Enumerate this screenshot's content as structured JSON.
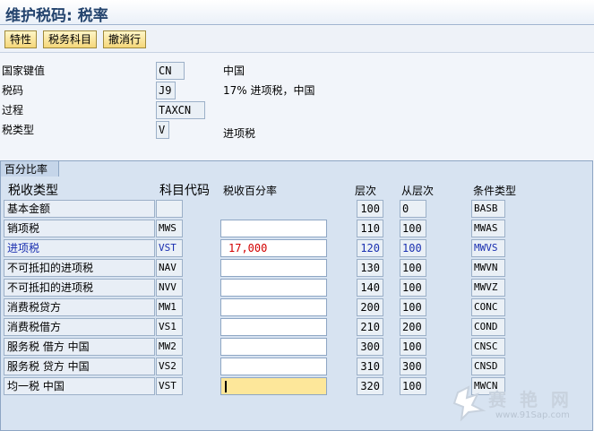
{
  "window": {
    "title": "维护税码: 税率"
  },
  "toolbar": {
    "buttons": [
      {
        "label": "特性"
      },
      {
        "label": "税务科目"
      },
      {
        "label": "撤消行"
      }
    ]
  },
  "header": {
    "country": {
      "label": "国家键值",
      "value": "CN",
      "description": "中国"
    },
    "tax_code": {
      "label": "税码",
      "value": "J9",
      "description": "17% 进项税，中国"
    },
    "procedure": {
      "label": "过程",
      "value": "TAXCN"
    },
    "tax_type": {
      "label": "税类型",
      "value": "V",
      "description": "进项税"
    }
  },
  "rates_group": {
    "title": "百分比率",
    "columns": {
      "tax_type": "税收类型",
      "account_key": "科目代码",
      "tax_percent": "税收百分率",
      "level": "层次",
      "from_level": "从层次",
      "condition_type": "条件类型"
    },
    "rows": [
      {
        "tax_type": "基本金额",
        "account_key": "",
        "rate": "",
        "level": "100",
        "from_level": "0",
        "condition": "BASB"
      },
      {
        "tax_type": "销项税",
        "account_key": "MWS",
        "rate": "",
        "level": "110",
        "from_level": "100",
        "condition": "MWAS"
      },
      {
        "tax_type": "进项税",
        "account_key": "VST",
        "rate": "17,000",
        "level": "120",
        "from_level": "100",
        "condition": "MWVS"
      },
      {
        "tax_type": "不可抵扣的进项税",
        "account_key": "NAV",
        "rate": "",
        "level": "130",
        "from_level": "100",
        "condition": "MWVN"
      },
      {
        "tax_type": "不可抵扣的进项税",
        "account_key": "NVV",
        "rate": "",
        "level": "140",
        "from_level": "100",
        "condition": "MWVZ"
      },
      {
        "tax_type": "消费税贷方",
        "account_key": "MW1",
        "rate": "",
        "level": "200",
        "from_level": "100",
        "condition": "CONC"
      },
      {
        "tax_type": "消费税借方",
        "account_key": "VS1",
        "rate": "",
        "level": "210",
        "from_level": "200",
        "condition": "COND"
      },
      {
        "tax_type": "服务税 借方 中国",
        "account_key": "MW2",
        "rate": "",
        "level": "300",
        "from_level": "100",
        "condition": "CNSC"
      },
      {
        "tax_type": "服务税 贷方 中国",
        "account_key": "VS2",
        "rate": "",
        "level": "310",
        "from_level": "300",
        "condition": "CNSD"
      },
      {
        "tax_type": "均一税 中国",
        "account_key": "VST",
        "rate": "",
        "level": "320",
        "from_level": "100",
        "condition": "MWCN"
      }
    ]
  },
  "watermark": {
    "text": "赛 艳 网",
    "url": "www.91Sap.com"
  },
  "colors": {
    "title": "#24446e",
    "highlight_text": "#1a2fb0",
    "rate_text": "#d20000",
    "focused_field": "#fde79a"
  }
}
